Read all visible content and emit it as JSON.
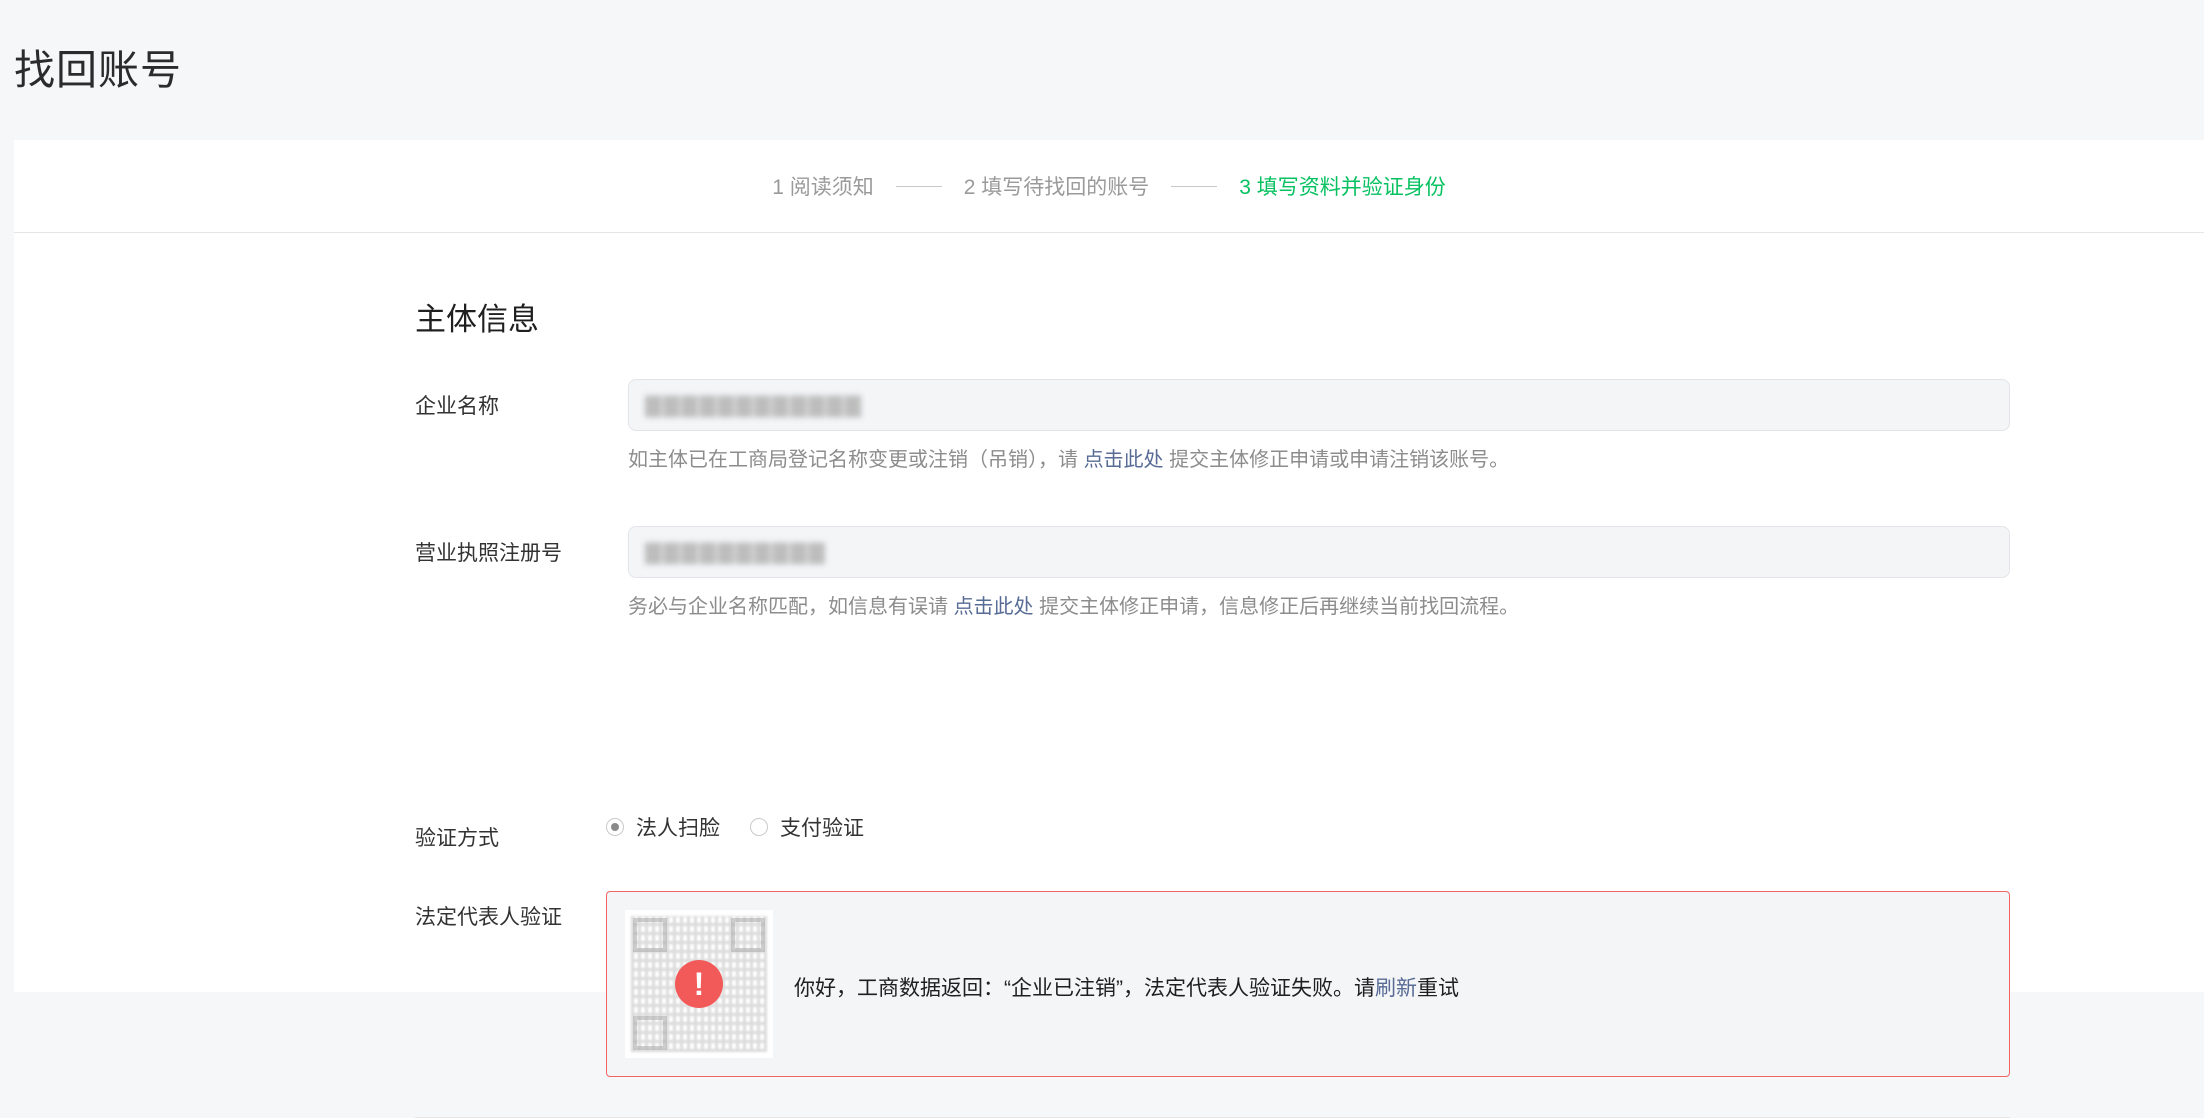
{
  "page": {
    "title": "找回账号"
  },
  "steps": [
    {
      "label": "1 阅读须知",
      "state": "done"
    },
    {
      "label": "2 填写待找回的账号",
      "state": "done"
    },
    {
      "label": "3 填写资料并验证身份",
      "state": "active"
    }
  ],
  "section": {
    "title": "主体信息"
  },
  "company_name": {
    "label": "企业名称",
    "hint_before": "如主体已在工商局登记名称变更或注销（吊销），请 ",
    "hint_link": "点击此处",
    "hint_after": " 提交主体修正申请或申请注销该账号。"
  },
  "license_no": {
    "label": "营业执照注册号",
    "hint_before": "务必与企业名称匹配，如信息有误请 ",
    "hint_link": "点击此处",
    "hint_after": " 提交主体修正申请，信息修正后再继续当前找回流程。"
  },
  "verify_method": {
    "label": "验证方式",
    "options": [
      {
        "label": "法人扫脸",
        "checked": true
      },
      {
        "label": "支付验证",
        "checked": false
      }
    ]
  },
  "legal_rep": {
    "label": "法定代表人验证",
    "message_before": "你好，工商数据返回：“企业已注销”，法定代表人验证失败。请",
    "message_link": "刷新",
    "message_after": "重试"
  },
  "colors": {
    "accent": "#07c160",
    "link": "#576b95",
    "error": "#f25a5a"
  }
}
